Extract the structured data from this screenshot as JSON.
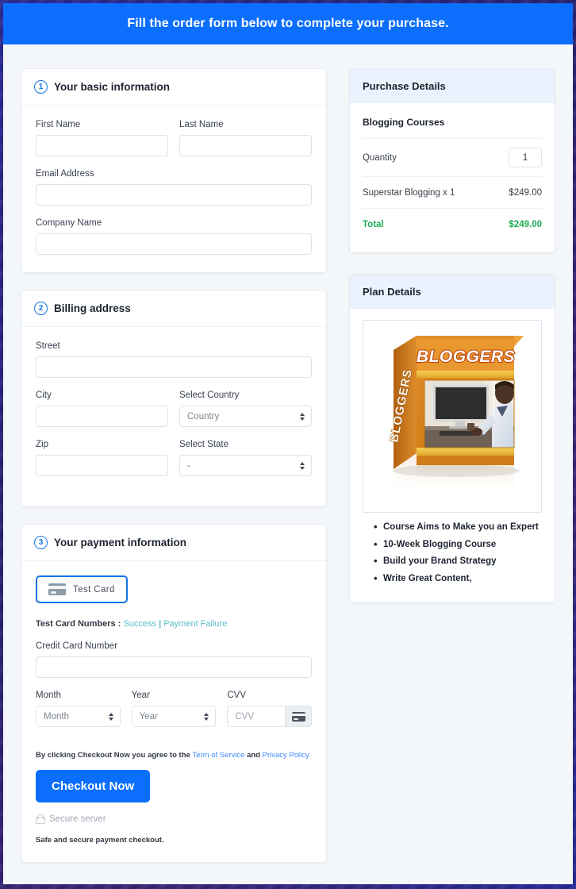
{
  "banner": {
    "text": "Fill the order form below to complete your purchase."
  },
  "colors": {
    "accent_blue": "#0b6efd",
    "panel_header": "#eaf2fd",
    "total_green": "#1fab54",
    "link_teal": "#5bbccb",
    "link_blue": "#3d8bfd",
    "frame_navy": "#23228c"
  },
  "sections": [
    {
      "number": "1",
      "title": "Your basic information",
      "fields": [
        {
          "label": "First Name",
          "value": "",
          "placeholder": ""
        },
        {
          "label": "Last Name",
          "value": "",
          "placeholder": ""
        },
        {
          "label": "Email Address",
          "value": "",
          "placeholder": ""
        },
        {
          "label": "Company Name",
          "value": "",
          "placeholder": ""
        }
      ]
    },
    {
      "number": "2",
      "title": "Billing address",
      "fields": [
        {
          "label": "Street",
          "value": "",
          "placeholder": ""
        },
        {
          "label": "City",
          "value": "",
          "placeholder": ""
        },
        {
          "label": "Select Country",
          "value": "Country",
          "placeholder": "Country"
        },
        {
          "label": "Zip",
          "value": "",
          "placeholder": ""
        },
        {
          "label": "Select State",
          "value": "-",
          "placeholder": "-"
        }
      ]
    },
    {
      "number": "3",
      "title": "Your payment information"
    }
  ],
  "payment": {
    "test_card_button": "Test  Card",
    "test_card_icon": "credit-card-icon",
    "test_numbers_label": "Test Card Numbers :",
    "test_numbers_success": "Success",
    "test_numbers_separator": "|",
    "test_numbers_failure": "Payment Failure",
    "credit_card_label": "Credit Card Number",
    "credit_card_value": "",
    "month_label": "Month",
    "month_value": "Month",
    "year_label": "Year",
    "year_value": "Year",
    "cvv_label": "CVV",
    "cvv_value": "",
    "cvv_placeholder": "CVV",
    "cvv_icon": "credit-card-icon",
    "terms_prefix": "By clicking Checkout Now you agree to the ",
    "terms_link_1": "Term of Service",
    "terms_middle": " and ",
    "terms_link_2": "Privacy Policy",
    "checkout_label": "Checkout Now",
    "secure_icon": "lock-icon",
    "secure_label": "Secure server",
    "safe_note": "Safe and secure payment checkout."
  },
  "purchase_details": {
    "header": "Purchase Details",
    "product_group": "Blogging Courses",
    "quantity_label": "Quantity",
    "quantity_value": "1",
    "line_item_label": "Superstar Blogging x 1",
    "line_item_price": "$249.00",
    "total_label": "Total",
    "total_price": "$249.00"
  },
  "plan_details": {
    "header": "Plan Details",
    "product_image_alt": "bloggers-course-box-image",
    "product_box_title": "BLOGGERS",
    "bullets": [
      "Course Aims to Make you an Expert",
      "10-Week Blogging Course",
      "Build your Brand Strategy",
      "Write Great Content,"
    ]
  }
}
